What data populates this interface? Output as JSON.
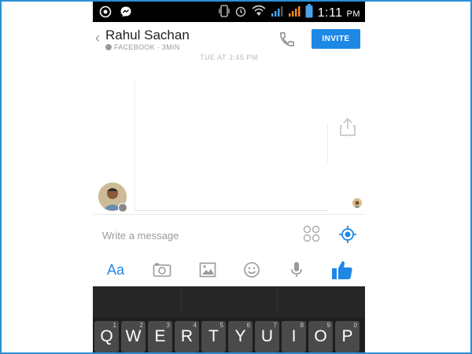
{
  "status_bar": {
    "time": "1:11",
    "ampm": "PM",
    "icons": [
      "whatsapp-icon",
      "messenger-icon",
      "vibrate-icon",
      "alarm-icon",
      "wifi-icon",
      "signal-icon",
      "signal-2-icon",
      "battery-icon"
    ]
  },
  "header": {
    "contact_name": "Rahul Sachan",
    "meta": "FACEBOOK · 3MIN",
    "invite_label": "INVITE"
  },
  "conversation": {
    "timestamp": "TUE AT 3:45 PM"
  },
  "composer": {
    "placeholder": "Write a message"
  },
  "toolbar": {
    "text_style_label": "Aa"
  },
  "keyboard": {
    "keys": [
      {
        "letter": "Q",
        "num": "1"
      },
      {
        "letter": "W",
        "num": "2"
      },
      {
        "letter": "E",
        "num": "3"
      },
      {
        "letter": "R",
        "num": "4"
      },
      {
        "letter": "T",
        "num": "5"
      },
      {
        "letter": "Y",
        "num": "6"
      },
      {
        "letter": "U",
        "num": "7"
      },
      {
        "letter": "I",
        "num": "8"
      },
      {
        "letter": "O",
        "num": "9"
      },
      {
        "letter": "P",
        "num": "0"
      }
    ]
  },
  "colors": {
    "accent": "#1e88e5",
    "frame_border": "#2c8fd6",
    "status_bar": "#000000",
    "keyboard_bg": "#1e1e1e",
    "key_bg": "#4a4a4a"
  }
}
